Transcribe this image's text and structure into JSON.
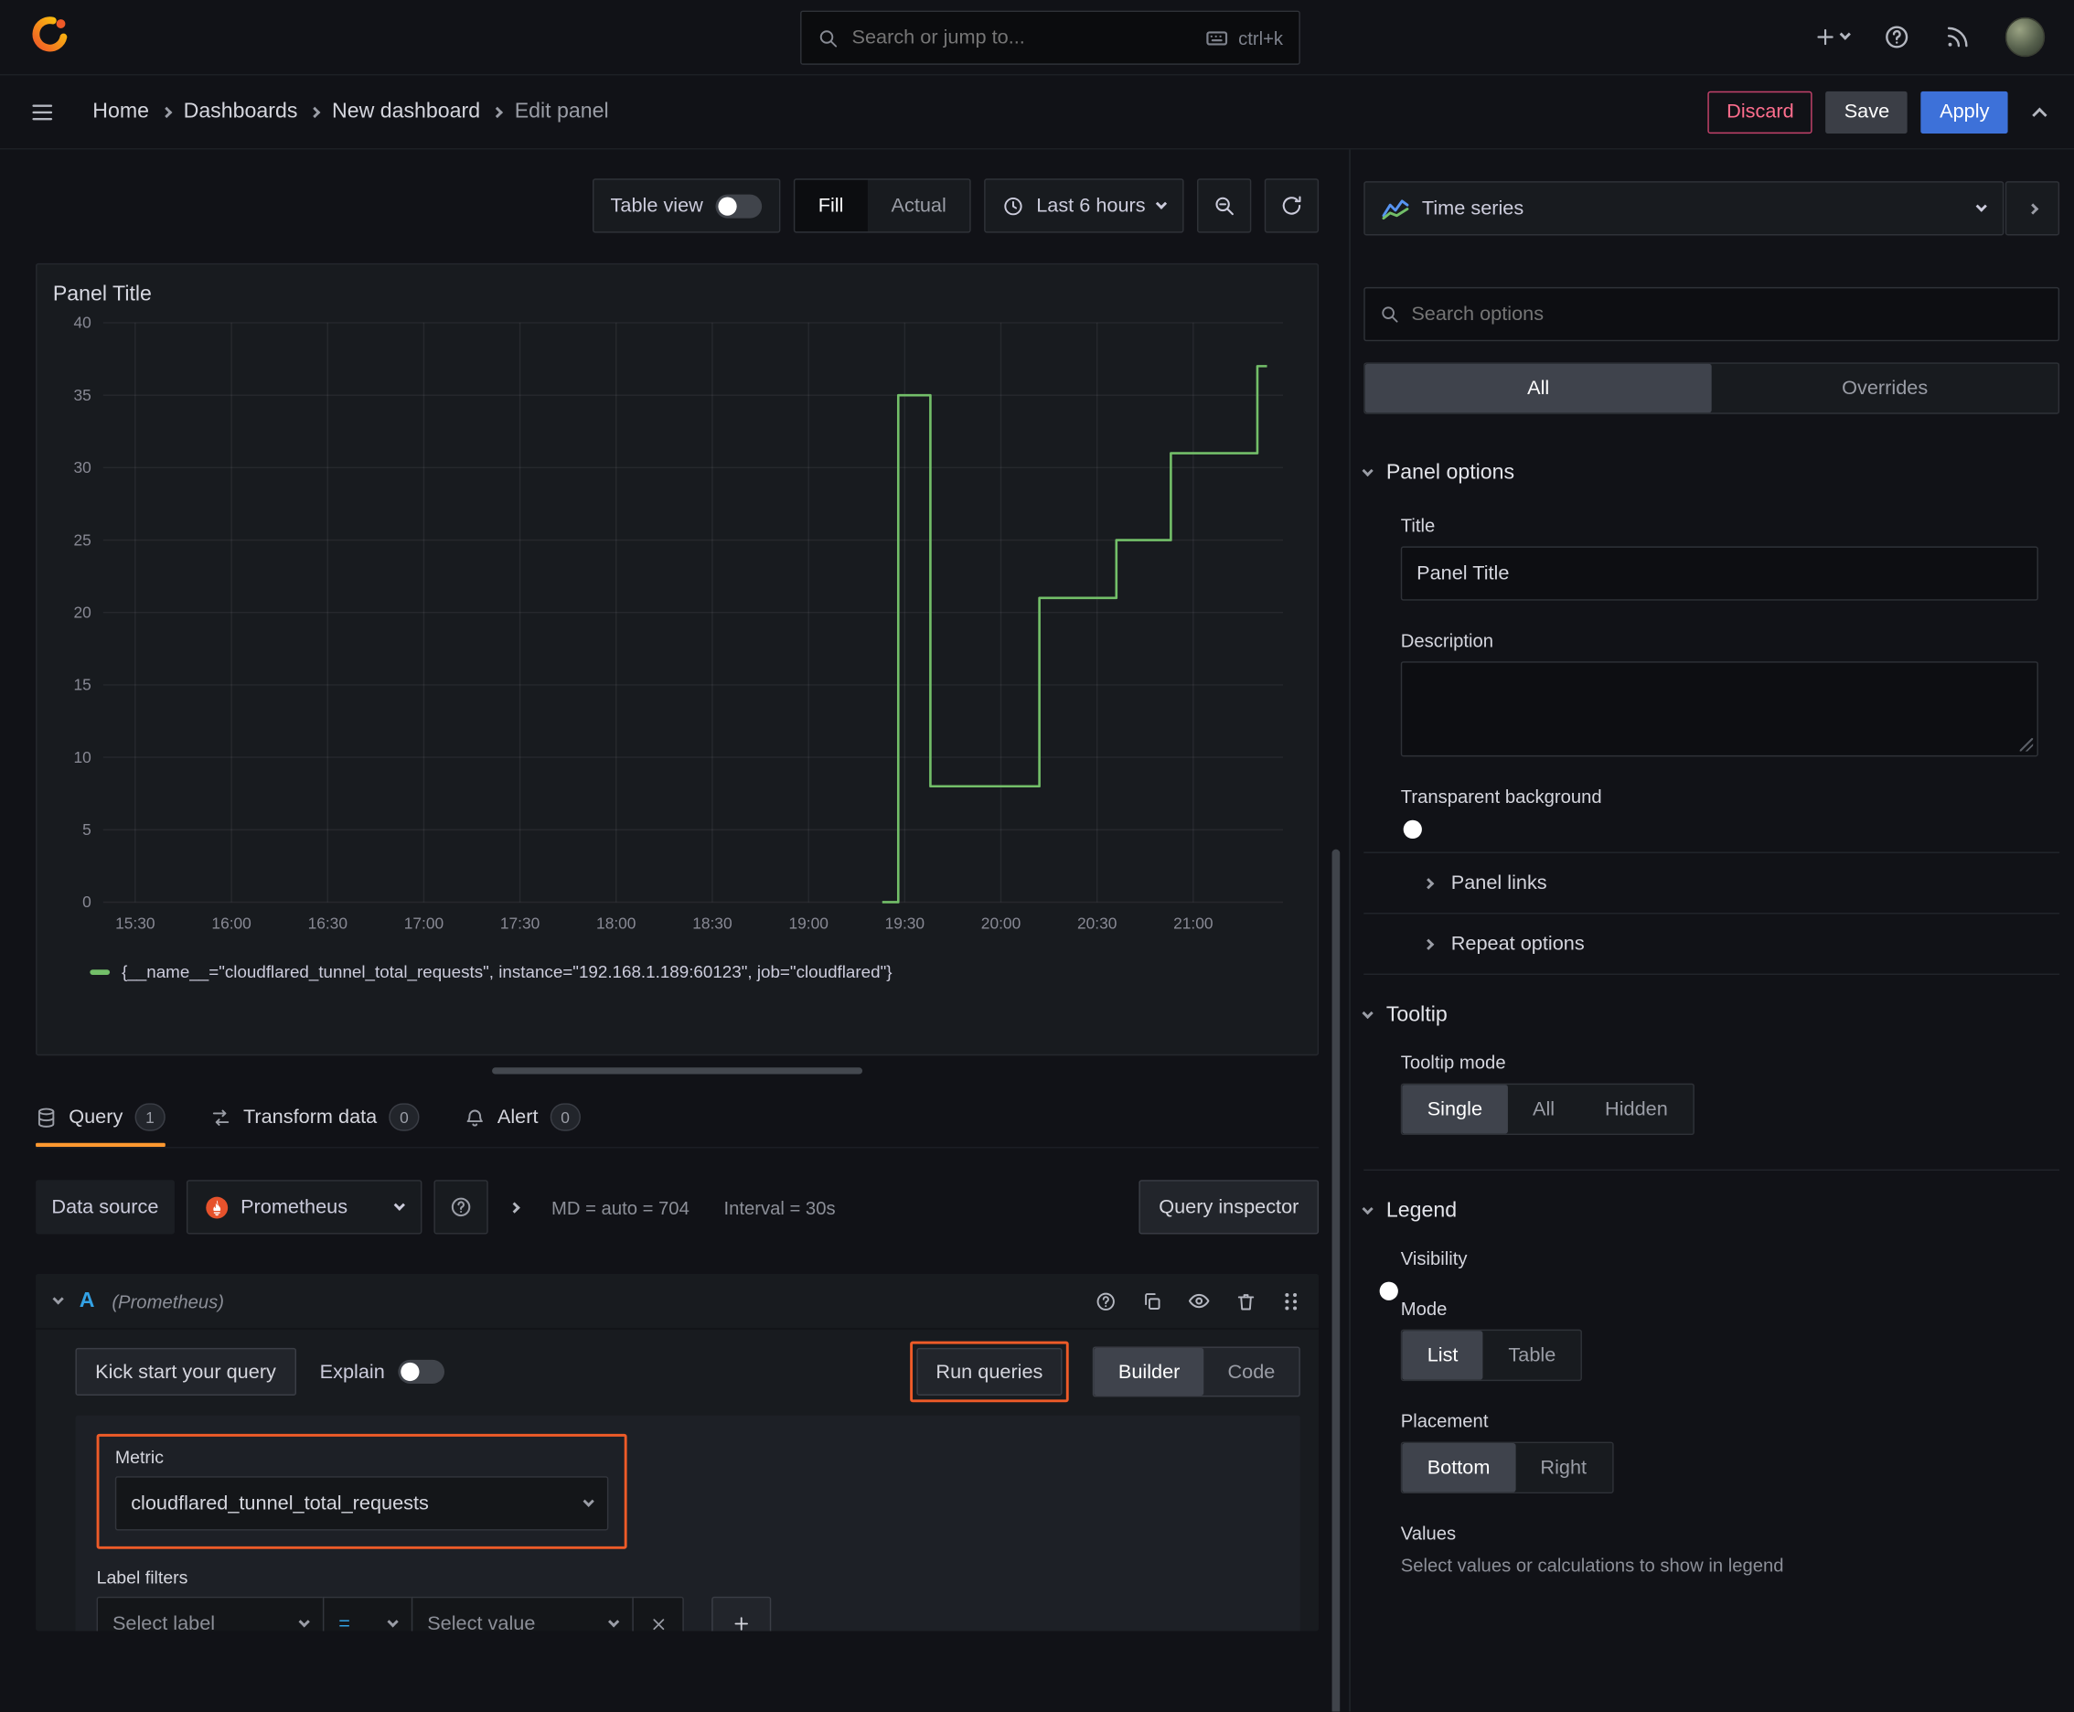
{
  "topbar": {
    "search_placeholder": "Search or jump to...",
    "search_shortcut": "ctrl+k"
  },
  "nav": {
    "breadcrumbs": [
      "Home",
      "Dashboards",
      "New dashboard",
      "Edit panel"
    ],
    "discard": "Discard",
    "save": "Save",
    "apply": "Apply"
  },
  "toolbar": {
    "table_view": "Table view",
    "table_view_on": false,
    "fill": "Fill",
    "actual": "Actual",
    "display_mode_selected": "Fill",
    "time_range": "Last 6 hours"
  },
  "panel": {
    "title": "Panel Title"
  },
  "chart_data": {
    "type": "line",
    "step": true,
    "title": "Panel Title",
    "ylim": [
      0,
      40
    ],
    "y_ticks": [
      0,
      5,
      10,
      15,
      20,
      25,
      30,
      35,
      40
    ],
    "x_unit": "minutes-of-day",
    "x_range": [
      920,
      1288
    ],
    "x_ticks": [
      {
        "label": "15:30",
        "m": 930
      },
      {
        "label": "16:00",
        "m": 960
      },
      {
        "label": "16:30",
        "m": 990
      },
      {
        "label": "17:00",
        "m": 1020
      },
      {
        "label": "17:30",
        "m": 1050
      },
      {
        "label": "18:00",
        "m": 1080
      },
      {
        "label": "18:30",
        "m": 1110
      },
      {
        "label": "19:00",
        "m": 1140
      },
      {
        "label": "19:30",
        "m": 1170
      },
      {
        "label": "20:00",
        "m": 1200
      },
      {
        "label": "20:30",
        "m": 1230
      },
      {
        "label": "21:00",
        "m": 1260
      }
    ],
    "grid": true,
    "legend_position": "bottom",
    "series": [
      {
        "name": "{__name__=\"cloudflared_tunnel_total_requests\", instance=\"192.168.1.189:60123\", job=\"cloudflared\"}",
        "color": "#73bf69",
        "points": [
          [
            1163,
            0
          ],
          [
            1168,
            0
          ],
          [
            1168,
            35
          ],
          [
            1178,
            35
          ],
          [
            1178,
            8
          ],
          [
            1212,
            8
          ],
          [
            1212,
            21
          ],
          [
            1236,
            21
          ],
          [
            1236,
            25
          ],
          [
            1253,
            25
          ],
          [
            1253,
            31
          ],
          [
            1280,
            31
          ],
          [
            1280,
            37
          ],
          [
            1283,
            37
          ]
        ]
      }
    ]
  },
  "tabs": {
    "query_label": "Query",
    "query_count": "1",
    "transform_label": "Transform data",
    "transform_count": "0",
    "alert_label": "Alert",
    "alert_count": "0"
  },
  "datasource_row": {
    "label": "Data source",
    "value": "Prometheus",
    "max_data_points": "MD = auto = 704",
    "interval": "Interval = 30s",
    "query_inspector": "Query inspector"
  },
  "query": {
    "ref_id": "A",
    "datasource_hint": "(Prometheus)",
    "kick_start": "Kick start your query",
    "explain": "Explain",
    "explain_on": false,
    "run_queries": "Run queries",
    "builder": "Builder",
    "code": "Code",
    "editor_mode_selected": "Builder",
    "metric_label": "Metric",
    "metric_value": "cloudflared_tunnel_total_requests",
    "label_filters": "Label filters",
    "select_label_placeholder": "Select label",
    "operator": "=",
    "select_value_placeholder": "Select value"
  },
  "options": {
    "viz_type": "Time series",
    "search_placeholder": "Search options",
    "filter_tabs": [
      "All",
      "Overrides"
    ],
    "filter_selected": "All",
    "panel_options": {
      "heading": "Panel options",
      "title_label": "Title",
      "title_value": "Panel Title",
      "description_label": "Description",
      "description_value": "",
      "transparent_bg": "Transparent background",
      "transparent_bg_on": false,
      "panel_links": "Panel links",
      "repeat_options": "Repeat options"
    },
    "tooltip": {
      "heading": "Tooltip",
      "mode_label": "Tooltip mode",
      "modes": [
        "Single",
        "All",
        "Hidden"
      ],
      "selected": "Single"
    },
    "legend": {
      "heading": "Legend",
      "visibility_label": "Visibility",
      "visibility_on": true,
      "mode_label": "Mode",
      "modes": [
        "List",
        "Table"
      ],
      "mode_selected": "List",
      "placement_label": "Placement",
      "placements": [
        "Bottom",
        "Right"
      ],
      "placement_selected": "Bottom",
      "values_label": "Values",
      "values_hint": "Select values or calculations to show in legend"
    }
  }
}
